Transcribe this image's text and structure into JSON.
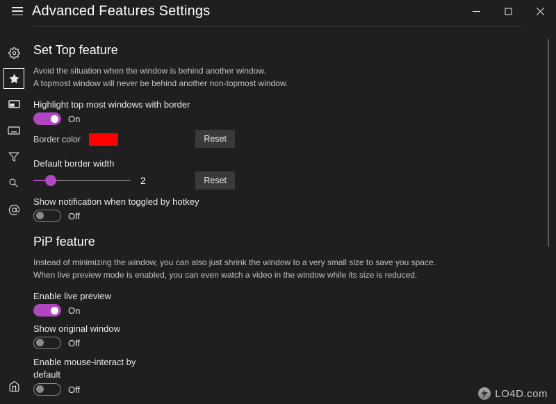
{
  "window": {
    "title": "Advanced Features Settings"
  },
  "sidebar": {
    "items": [
      {
        "name": "settings",
        "icon": "gear-icon"
      },
      {
        "name": "features",
        "icon": "star-icon",
        "active": true
      },
      {
        "name": "taskbar",
        "icon": "taskbar-icon"
      },
      {
        "name": "keyboard",
        "icon": "keyboard-icon"
      },
      {
        "name": "filter",
        "icon": "funnel-icon"
      },
      {
        "name": "search",
        "icon": "magnifier-icon"
      },
      {
        "name": "about",
        "icon": "at-icon"
      }
    ],
    "home_label": "Home"
  },
  "sections": {
    "set_top": {
      "title": "Set Top feature",
      "desc_line1": "Avoid the situation when the window is behind another window.",
      "desc_line2": "A topmost window will never be behind another non-topmost window.",
      "highlight_label": "Highlight top most windows with border",
      "highlight_state": "On",
      "border_color_label": "Border color",
      "border_color_value": "#ff0000",
      "reset_label": "Reset",
      "border_width_label": "Default border width",
      "border_width_value": "2",
      "notify_label": "Show notification when toggled by hotkey",
      "notify_state": "Off"
    },
    "pip": {
      "title": "PiP feature",
      "desc_line1": "Instead of minimizing the window, you can also just shrink the window to a very small size to save you space.",
      "desc_line2": "When live preview mode is enabled, you can even watch a video in the window while its size is reduced.",
      "live_preview_label": "Enable live preview",
      "live_preview_state": "On",
      "show_original_label": "Show original window",
      "show_original_state": "Off",
      "mouse_interact_label_1": "Enable mouse-interact by",
      "mouse_interact_label_2": "default",
      "mouse_interact_state": "Off"
    }
  },
  "watermark": {
    "text": "LO4D.com"
  }
}
